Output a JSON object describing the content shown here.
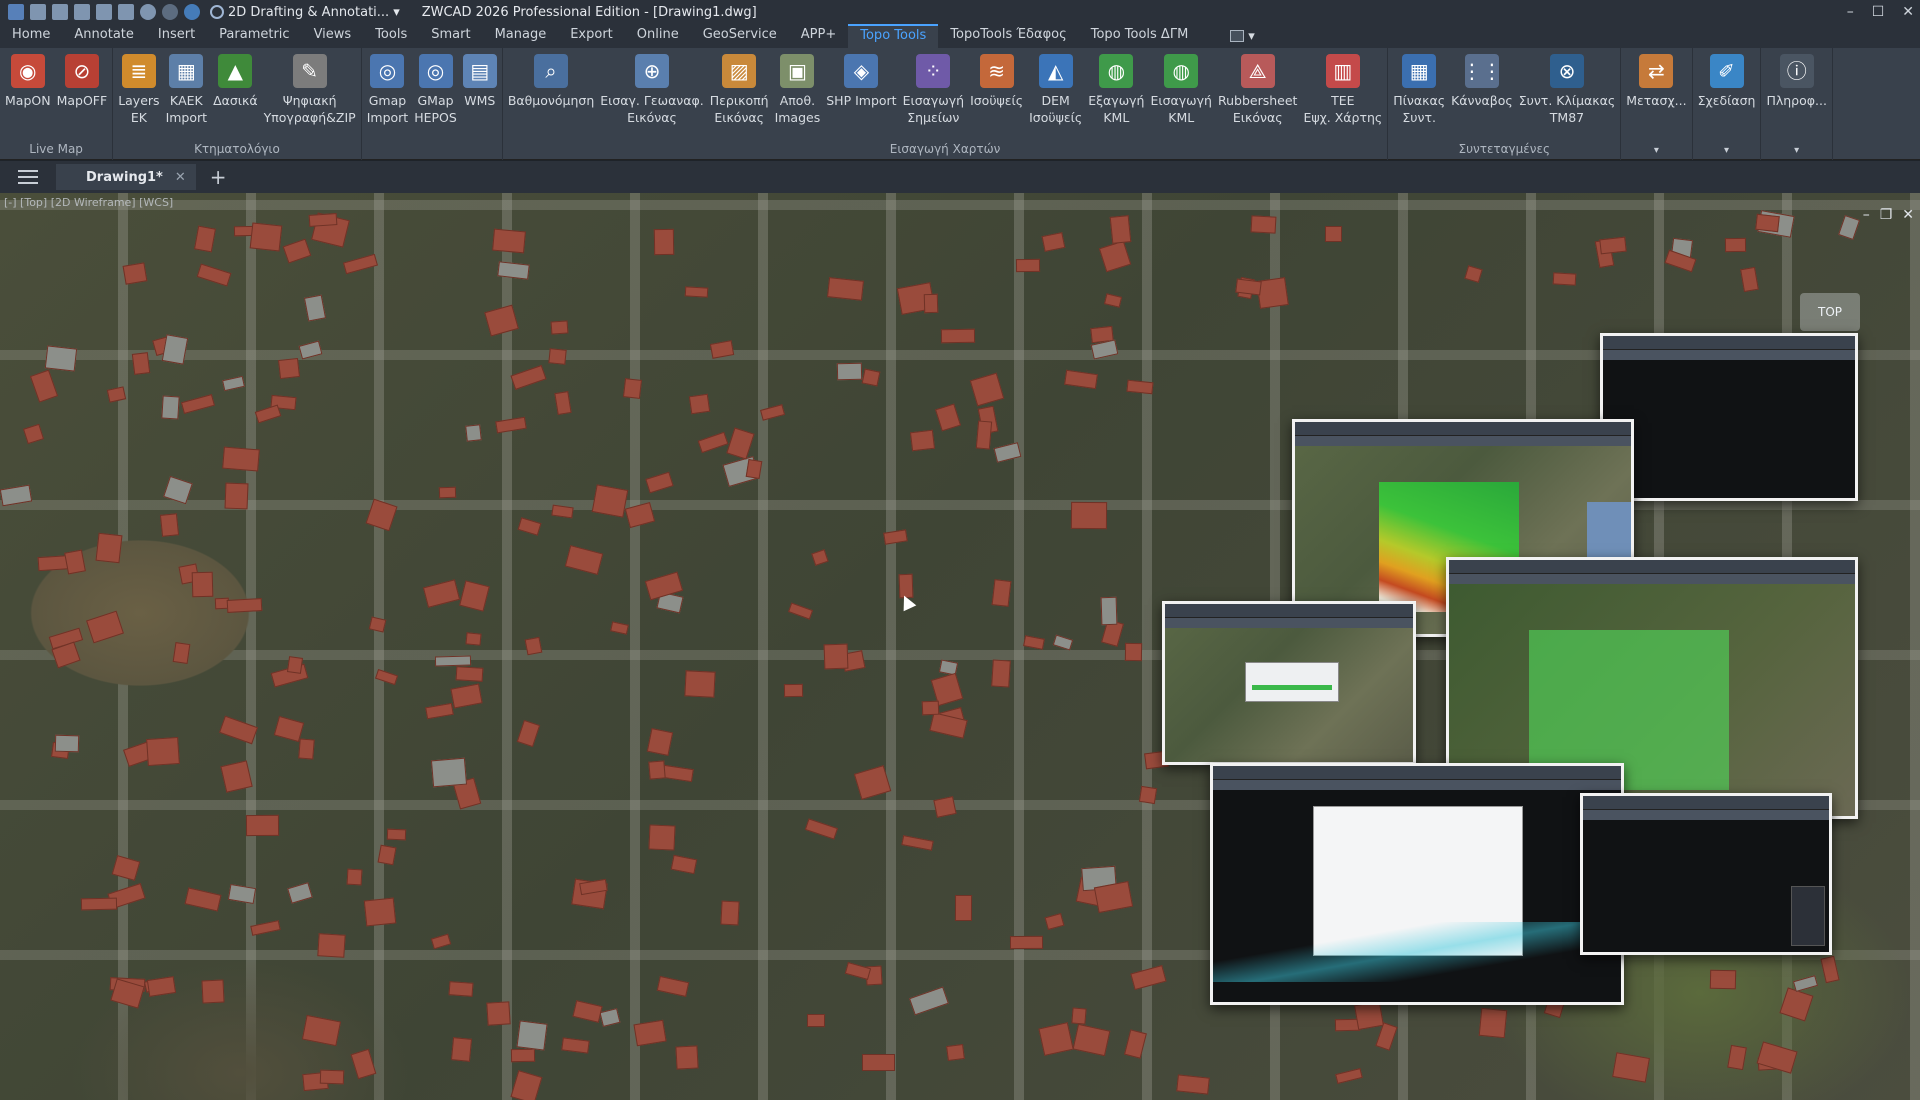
{
  "titlebar": {
    "workspace": "2D Drafting & Annotati...",
    "app_title": "ZWCAD 2026 Professional Edition - [Drawing1.dwg]",
    "min": "–",
    "max": "☐",
    "close": "✕"
  },
  "menu": [
    "Home",
    "Annotate",
    "Insert",
    "Parametric",
    "Views",
    "Tools",
    "Smart",
    "Manage",
    "Export",
    "Online",
    "GeoService",
    "APP+",
    "Topo Tools",
    "TopoTools Έδαφος",
    "Topo Tools ΔΓΜ"
  ],
  "menu_active": "Topo Tools",
  "ribbon": {
    "groups": [
      {
        "label": "Live Map",
        "buttons": [
          {
            "line1": "MapON",
            "line2": "",
            "color": "#c64a3a",
            "glyph": "◉"
          },
          {
            "line1": "MapOFF",
            "line2": "",
            "color": "#b84034",
            "glyph": "⊘"
          }
        ]
      },
      {
        "label": "Κτηματολόγιο",
        "buttons": [
          {
            "line1": "Layers",
            "line2": "EK",
            "color": "#d08b2c",
            "glyph": "≣"
          },
          {
            "line1": "ΚΑΕΚ",
            "line2": "Import",
            "color": "#5d7fa8",
            "glyph": "▦"
          },
          {
            "line1": "Δασικά",
            "line2": "",
            "color": "#3f8a3a",
            "glyph": "▲"
          },
          {
            "line1": "Ψηφιακή",
            "line2": "Υπογραφή&ZIP",
            "color": "#7c7c7c",
            "glyph": "✎"
          }
        ]
      },
      {
        "label": "",
        "buttons": [
          {
            "line1": "Gmap",
            "line2": "Import",
            "color": "#4b76b0",
            "glyph": "◎"
          },
          {
            "line1": "GMap",
            "line2": "HEPOS",
            "color": "#4b76b0",
            "glyph": "◎"
          },
          {
            "line1": "WMS",
            "line2": "",
            "color": "#5e84b5",
            "glyph": "▤"
          }
        ]
      },
      {
        "label": "Εισαγωγή Χαρτών",
        "buttons": [
          {
            "line1": "Βαθμονόμηση",
            "line2": "",
            "color": "#4a6f9e",
            "glyph": "⌕"
          },
          {
            "line1": "Εισαγ. Γεωαναφ.",
            "line2": "Εικόνας",
            "color": "#5a7fae",
            "glyph": "⊕"
          },
          {
            "line1": "Περικοπή",
            "line2": "Εικόνας",
            "color": "#c9893a",
            "glyph": "▨"
          },
          {
            "line1": "Αποθ.",
            "line2": "Images",
            "color": "#7d8f6a",
            "glyph": "▣"
          },
          {
            "line1": "SHP Import",
            "line2": "",
            "color": "#4b76b0",
            "glyph": "◈"
          },
          {
            "line1": "Εισαγωγή",
            "line2": "Σημείων",
            "color": "#6f5aa8",
            "glyph": "⁘"
          },
          {
            "line1": "Ισοϋψείς",
            "line2": "",
            "color": "#c4683a",
            "glyph": "≋"
          },
          {
            "line1": "DEM",
            "line2": "Ισοϋψείς",
            "color": "#3b74b8",
            "glyph": "◭"
          },
          {
            "line1": "Εξαγωγή",
            "line2": "KML",
            "color": "#3f9a4a",
            "glyph": "◍"
          },
          {
            "line1": "Εισαγωγή",
            "line2": "KML",
            "color": "#3f9a4a",
            "glyph": "◍"
          },
          {
            "line1": "Rubbersheet",
            "line2": "Εικόνας",
            "color": "#b85a5a",
            "glyph": "⟁"
          },
          {
            "line1": "TEE",
            "line2": "Εψχ. Χάρτης",
            "color": "#c44a4a",
            "glyph": "▥"
          }
        ]
      },
      {
        "label": "Συντεταγμένες",
        "buttons": [
          {
            "line1": "Πίνακας",
            "line2": "Συντ.",
            "color": "#3b6fb0",
            "glyph": "▦"
          },
          {
            "line1": "Κάνναβος",
            "line2": "",
            "color": "#5a6f8e",
            "glyph": "⋮⋮"
          },
          {
            "line1": "Συντ. Κλίμακας",
            "line2": "TM87",
            "color": "#2f5f8e",
            "glyph": "⊗"
          }
        ]
      },
      {
        "label": "",
        "dropdown": true,
        "buttons": [
          {
            "line1": "Μετασχ...",
            "line2": "",
            "color": "#c67a3a",
            "glyph": "⇄"
          }
        ]
      },
      {
        "label": "",
        "dropdown": true,
        "buttons": [
          {
            "line1": "Σχεδίαση",
            "line2": "",
            "color": "#3a86c6",
            "glyph": "✐"
          }
        ]
      },
      {
        "label": "",
        "dropdown": true,
        "buttons": [
          {
            "line1": "Πληροφ...",
            "line2": "",
            "color": "#4a5562",
            "glyph": "ⓘ"
          }
        ]
      }
    ]
  },
  "doc_tabs": {
    "active": "Drawing1*",
    "close": "✕",
    "new": "+"
  },
  "viewport": {
    "label": "[-] [Top] [2D Wireframe] [WCS]",
    "view_cube": "TOP"
  },
  "icons": [
    "app-icon",
    "new-icon",
    "open-icon",
    "save-icon",
    "saveas-icon",
    "print-icon",
    "undo-icon",
    "redo-icon",
    "help-icon",
    "gear-icon"
  ]
}
